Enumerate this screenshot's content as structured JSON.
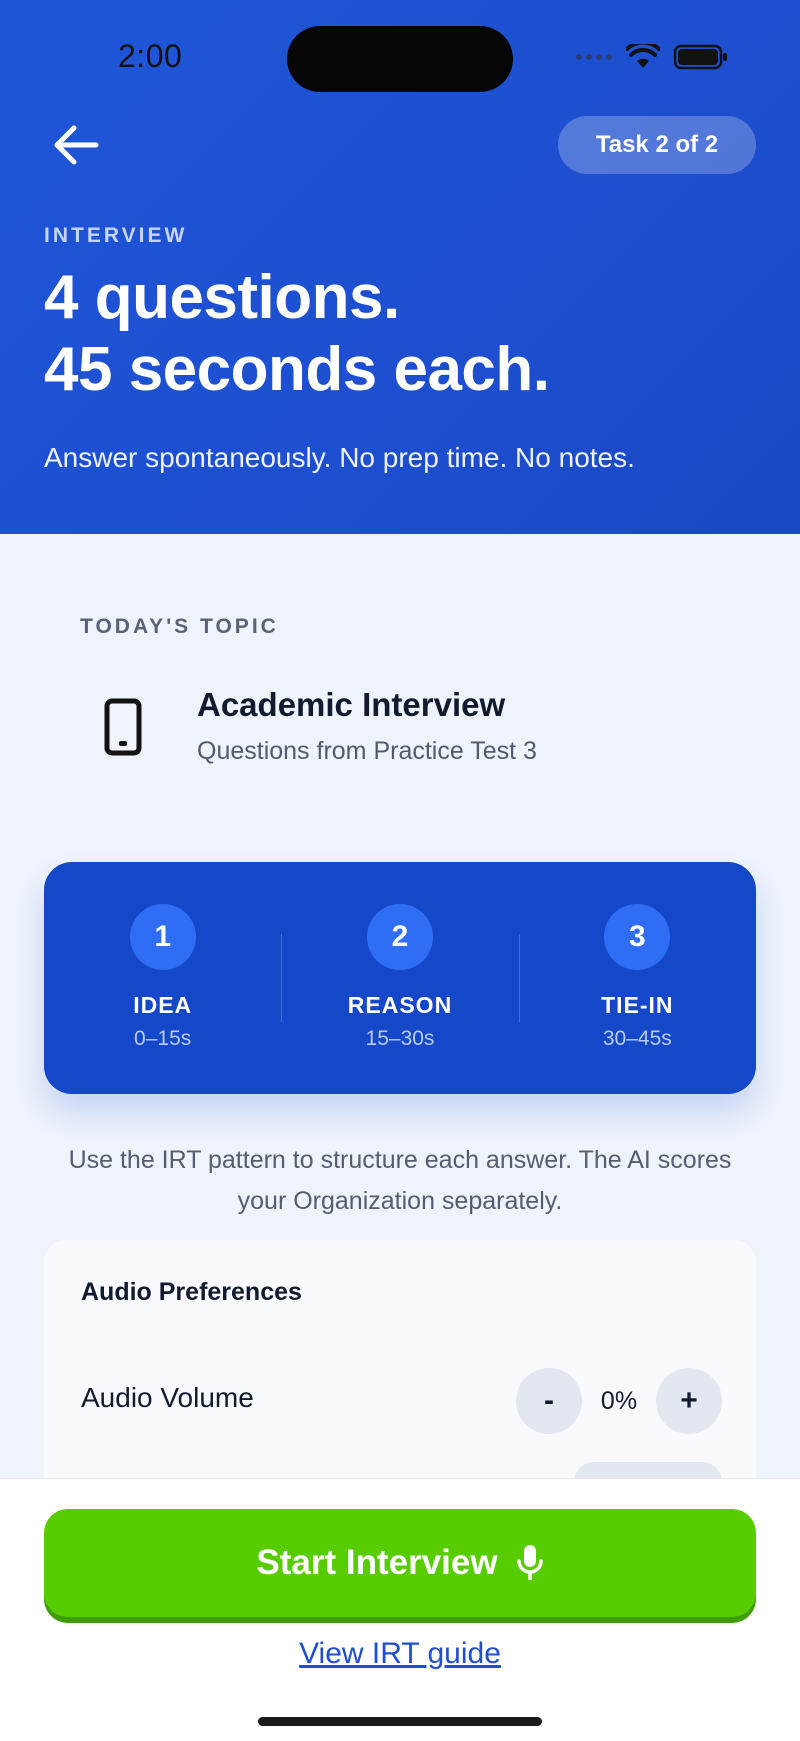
{
  "status_bar": {
    "time": "2:00"
  },
  "header": {
    "task_pill": "Task 2 of 2",
    "eyebrow": "INTERVIEW",
    "headline_line1": "4 questions.",
    "headline_line2": "45 seconds each.",
    "subline": "Answer spontaneously. No prep time. No notes."
  },
  "topic": {
    "label": "TODAY'S TOPIC",
    "title": "Academic Interview",
    "subtitle": "Questions from Practice Test 3",
    "icon": "phone-icon"
  },
  "irt": {
    "steps": [
      {
        "num": "1",
        "name": "IDEA",
        "time": "0–15s"
      },
      {
        "num": "2",
        "name": "REASON",
        "time": "15–30s"
      },
      {
        "num": "3",
        "name": "TIE-IN",
        "time": "30–45s"
      }
    ],
    "note": "Use the IRT pattern to structure each answer. The AI scores your Organization separately."
  },
  "preferences": {
    "title": "Audio Preferences",
    "volume_label": "Audio Volume",
    "minus": "-",
    "plus": "+",
    "volume_value": "0%"
  },
  "footer": {
    "start_label": "Start Interview",
    "guide_link": "View IRT guide"
  },
  "colors": {
    "header_blue": "#1f56d8",
    "card_blue": "#1448c8",
    "start_green": "#57cc00",
    "link_blue": "#1f4fd0"
  }
}
